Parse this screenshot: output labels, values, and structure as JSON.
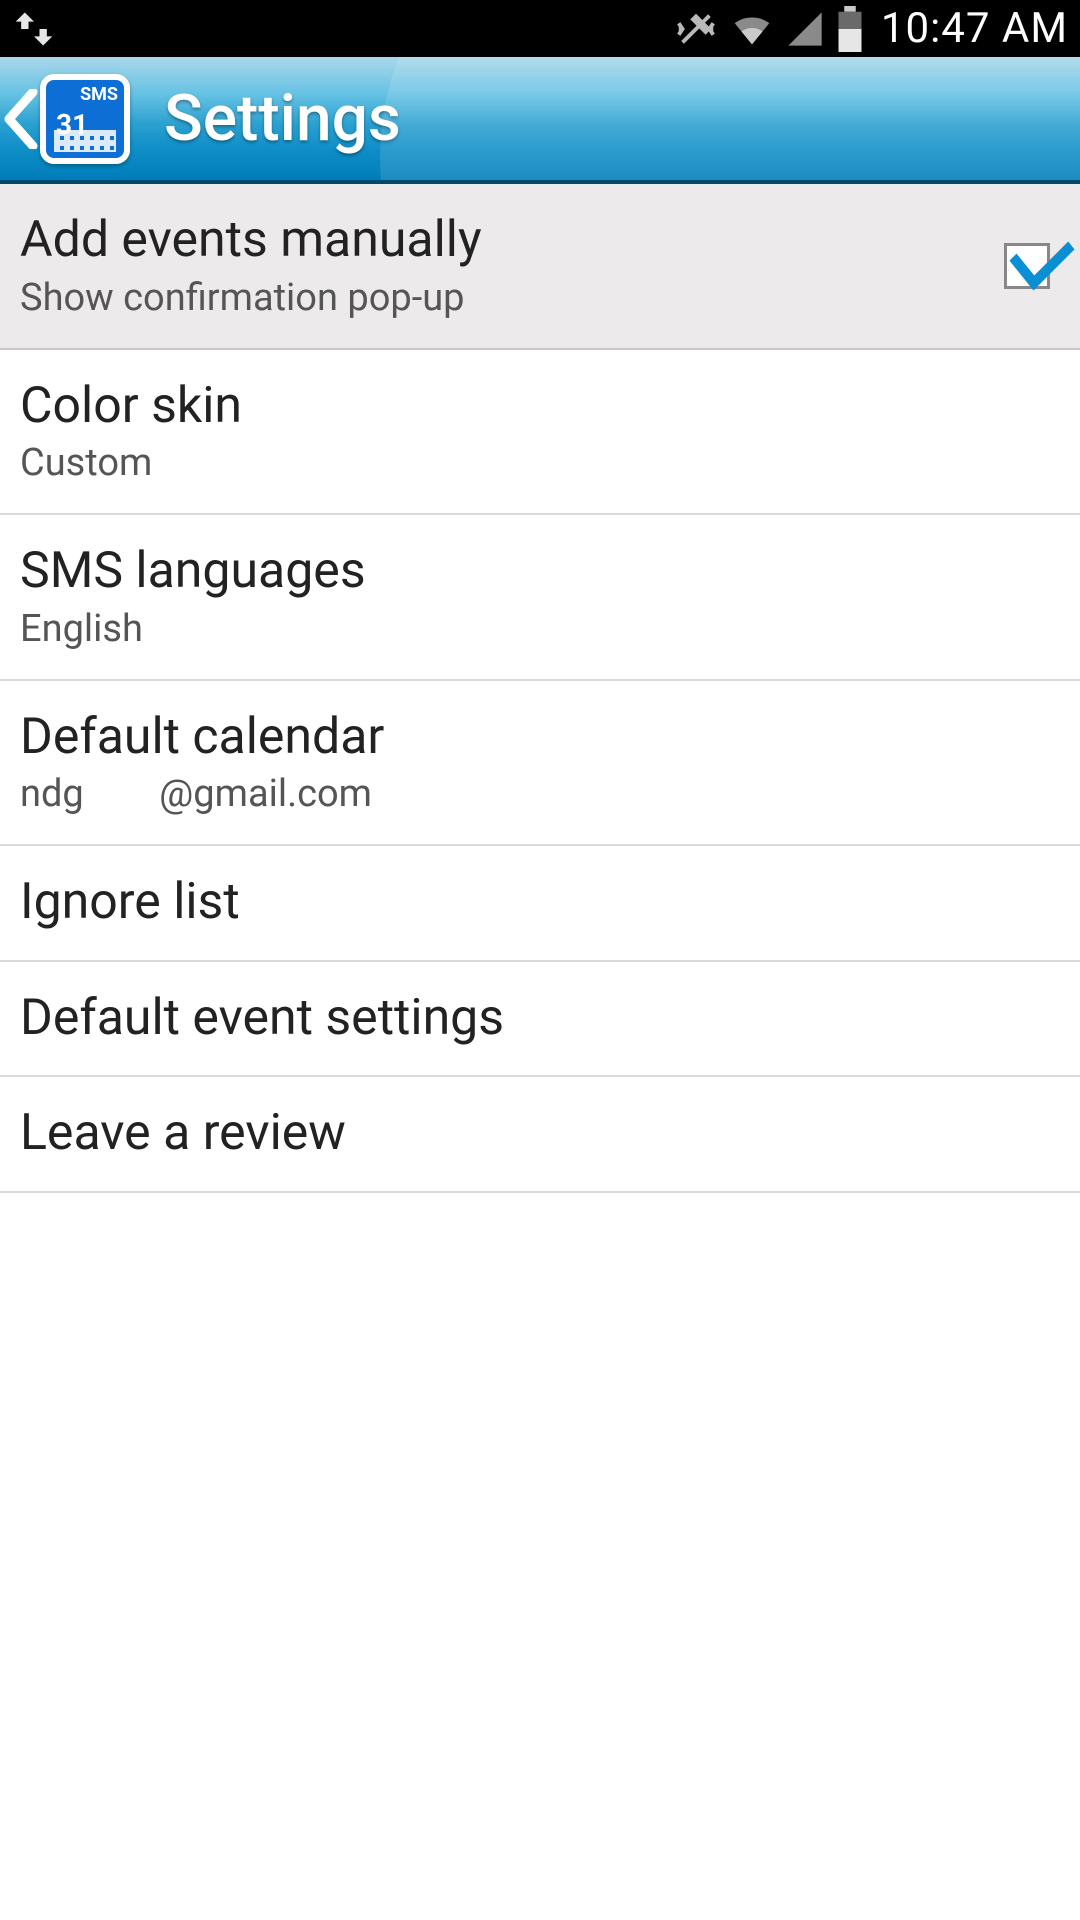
{
  "status": {
    "time": "10:47 AM"
  },
  "header": {
    "title": "Settings"
  },
  "items": [
    {
      "title": "Add events manually",
      "subtitle": "Show confirmation pop-up",
      "checked": true
    },
    {
      "title": "Color skin",
      "subtitle": "Custom"
    },
    {
      "title": "SMS languages",
      "subtitle": "English"
    },
    {
      "title": "Default calendar",
      "subtitle": "ndg        @gmail.com"
    },
    {
      "title": "Ignore list"
    },
    {
      "title": "Default event settings"
    },
    {
      "title": "Leave a review"
    }
  ]
}
